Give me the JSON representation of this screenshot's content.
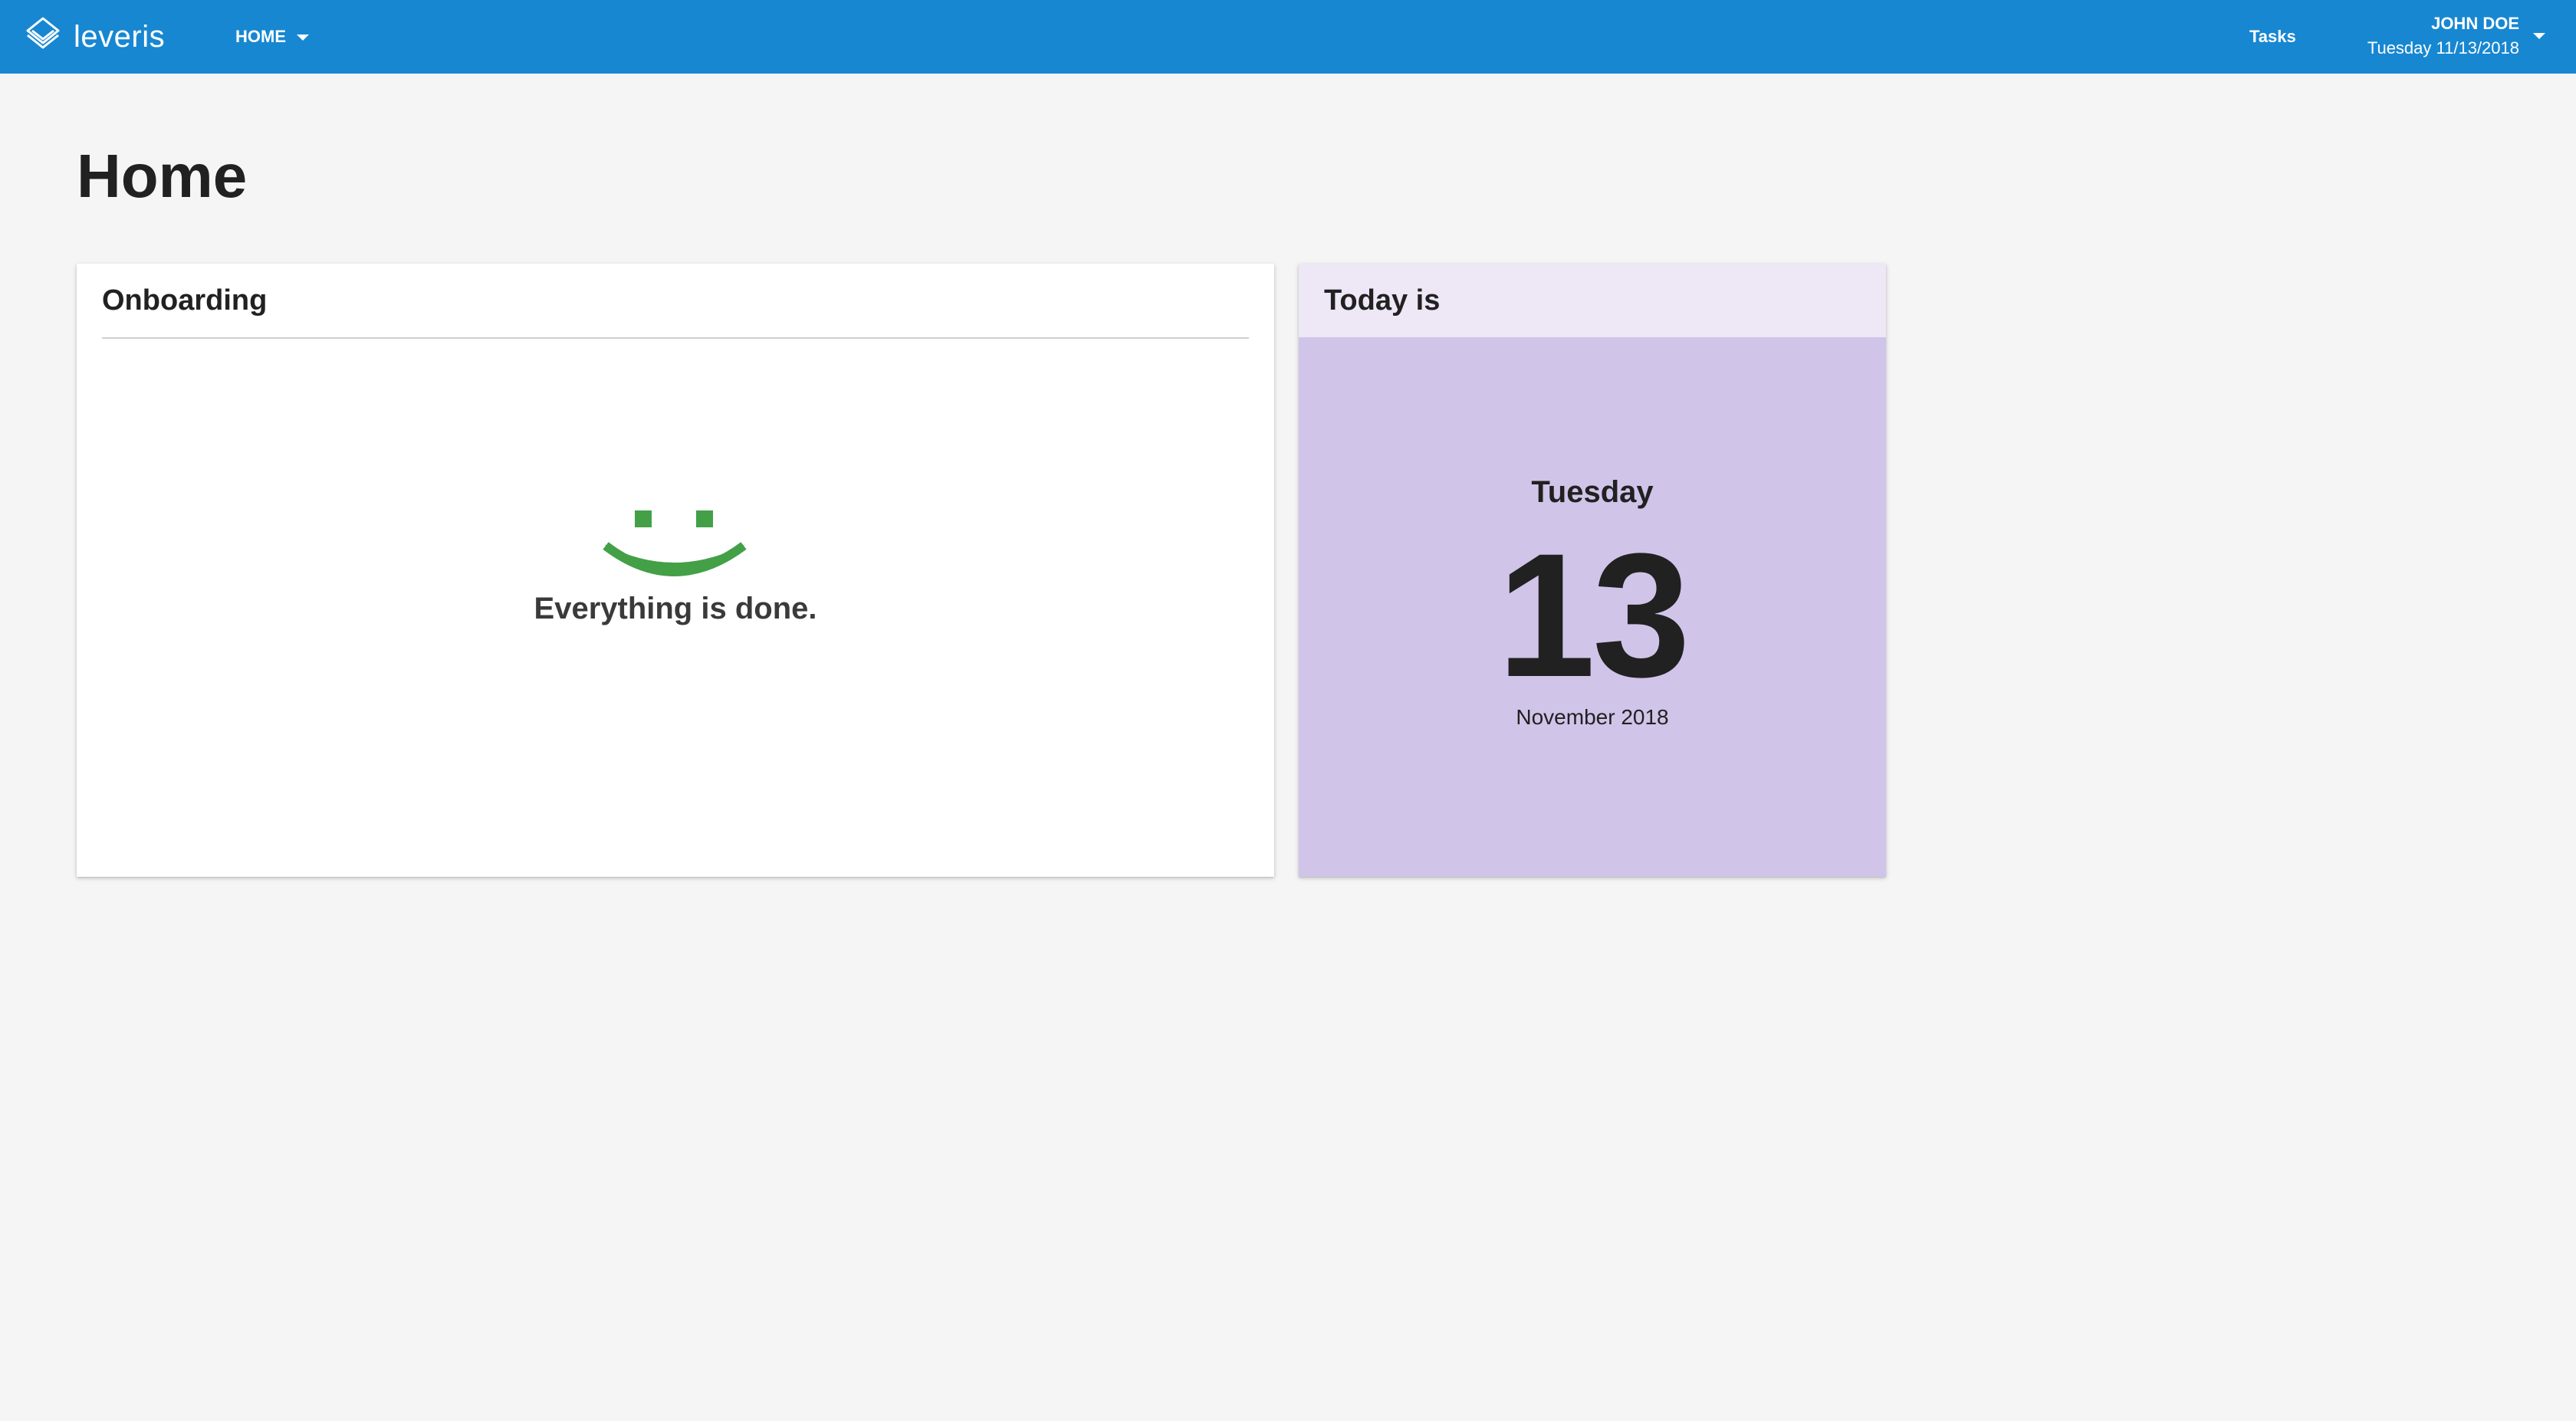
{
  "app": {
    "logo_text": "leveris"
  },
  "nav": {
    "home_label": "HOME",
    "tasks_label": "Tasks"
  },
  "user": {
    "name": "JOHN DOE",
    "date": "Tuesday 11/13/2018"
  },
  "page": {
    "title": "Home"
  },
  "onboarding": {
    "title": "Onboarding",
    "status_text": "Everything is done.",
    "status_icon": "smiley-icon",
    "accent_color": "#43a047"
  },
  "today": {
    "title": "Today is",
    "weekday": "Tuesday",
    "day": "13",
    "month_year": "November 2018",
    "background_color": "#d1c4e9",
    "header_color": "#ede7f6"
  },
  "colors": {
    "topbar": "#1787d2",
    "page_background": "#f5f5f5"
  }
}
